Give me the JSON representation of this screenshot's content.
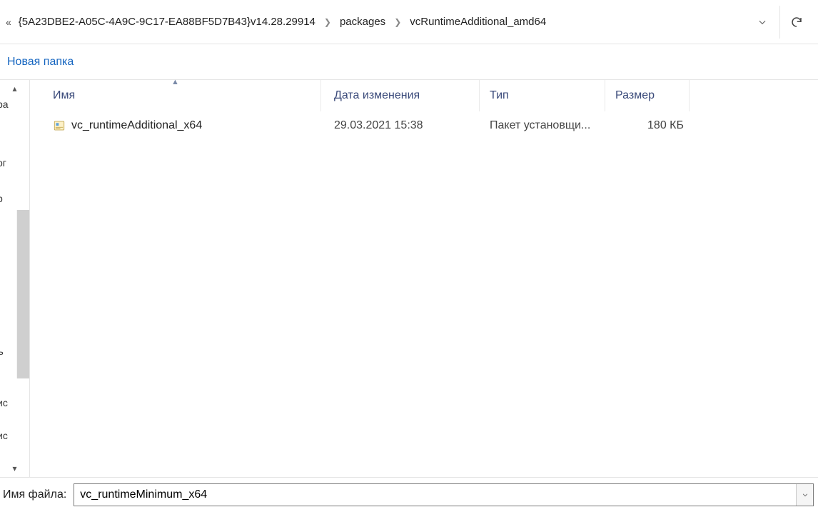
{
  "breadcrumb": {
    "overflow": "«",
    "segments": [
      "{5A23DBE2-A05C-4A9C-9C17-EA88BF5D7B43}v14.28.29914",
      "packages",
      "vcRuntimeAdditional_amd64"
    ]
  },
  "toolbar": {
    "new_folder_label": "Новая папка"
  },
  "left_nav": {
    "fragments": [
      "ра",
      "ог",
      "р",
      "ъ",
      "ис",
      "ис"
    ]
  },
  "columns": {
    "name": "Имя",
    "date": "Дата изменения",
    "type": "Тип",
    "size": "Размер"
  },
  "files": [
    {
      "name": "vc_runtimeAdditional_x64",
      "date": "29.03.2021 15:38",
      "type": "Пакет установщи...",
      "size": "180 КБ"
    }
  ],
  "filename_bar": {
    "label": "Имя файла:",
    "value": "vc_runtimeMinimum_x64"
  }
}
